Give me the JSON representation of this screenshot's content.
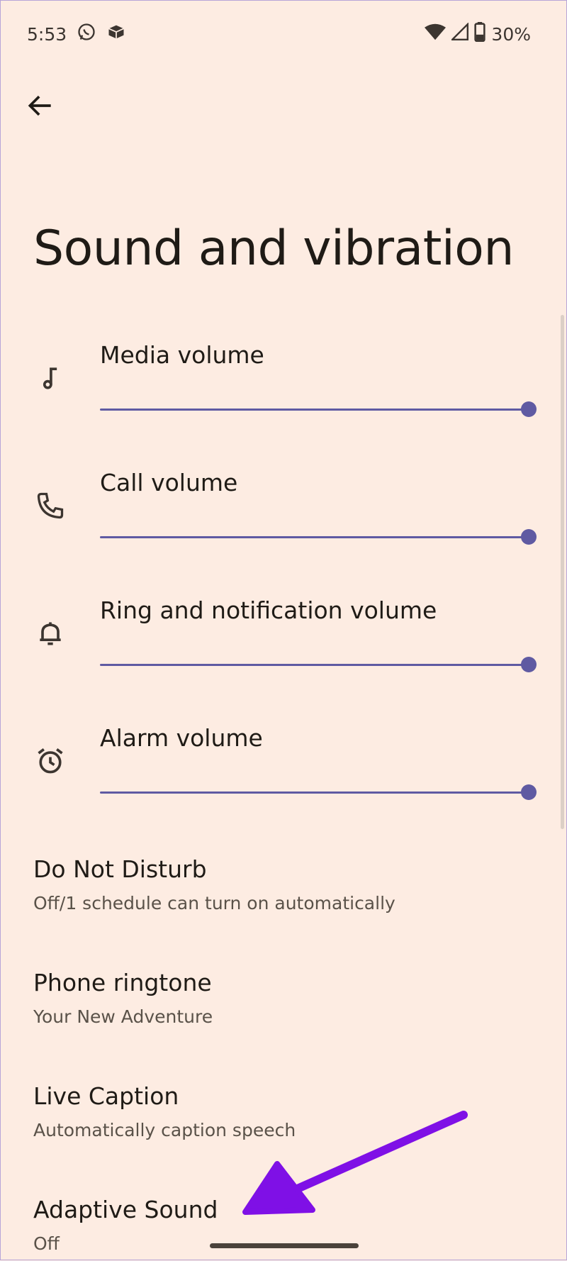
{
  "status_bar": {
    "time": "5:53",
    "battery": "30%"
  },
  "header": {
    "title": "Sound and vibration"
  },
  "volumes": [
    {
      "label": "Media volume",
      "icon": "music-note-icon",
      "level": 1.0
    },
    {
      "label": "Call volume",
      "icon": "phone-icon",
      "level": 1.0
    },
    {
      "label": "Ring and notification volume",
      "icon": "bell-icon",
      "level": 1.0
    },
    {
      "label": "Alarm volume",
      "icon": "alarm-clock-icon",
      "level": 1.0
    }
  ],
  "preferences": [
    {
      "title": "Do Not Disturb",
      "summary": "Off/1 schedule can turn on automatically"
    },
    {
      "title": "Phone ringtone",
      "summary": "Your New Adventure"
    },
    {
      "title": "Live Caption",
      "summary": "Automatically caption speech"
    },
    {
      "title": "Adaptive Sound",
      "summary": "Off"
    }
  ],
  "colors": {
    "background": "#fdece2",
    "slider": "#5f5aa2",
    "annotation_arrow": "#7f10e6"
  }
}
